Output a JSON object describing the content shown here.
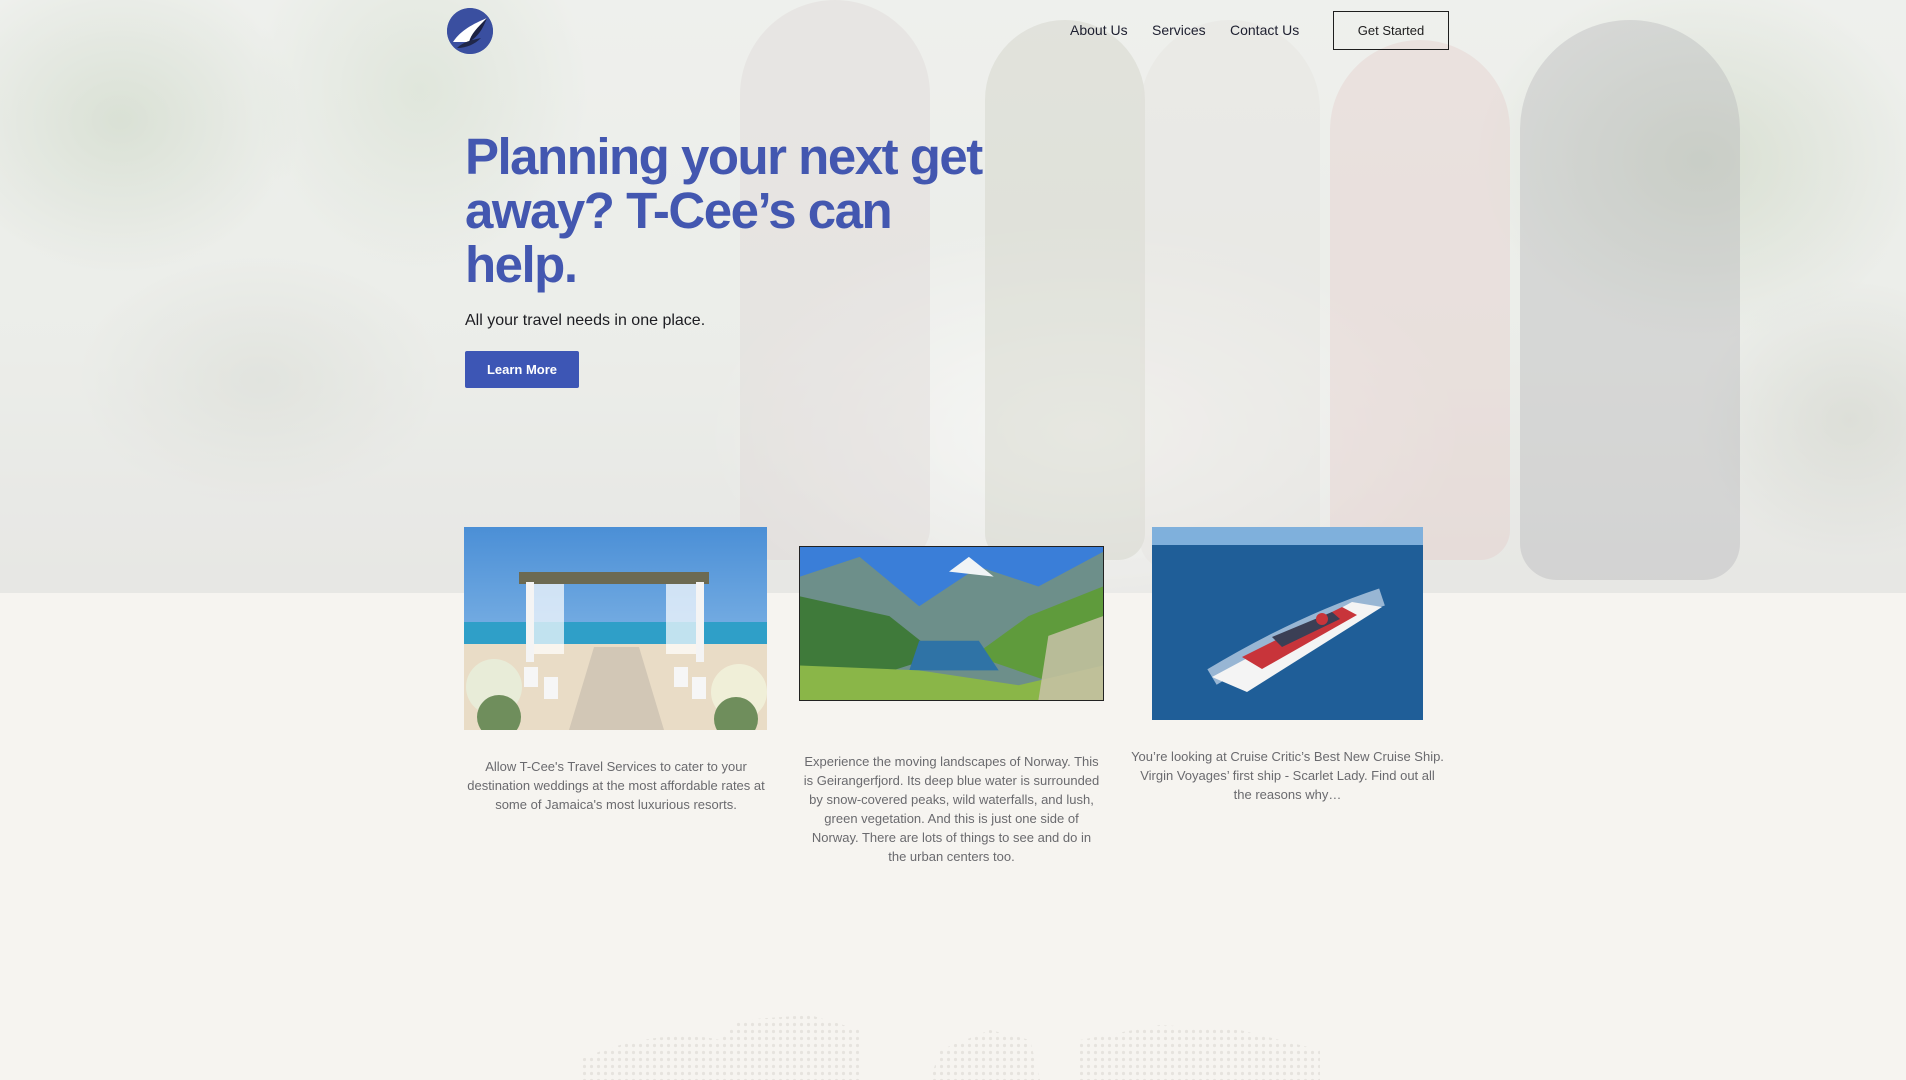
{
  "nav": {
    "links": [
      "About Us",
      "Services",
      "Contact Us"
    ],
    "cta_label": "Get Started"
  },
  "hero": {
    "headline": "Planning your next get away? T-Cee’s can help.",
    "subline": "All your travel needs in one place.",
    "button_label": "Learn More"
  },
  "cards": [
    {
      "text": "Allow T-Cee's Travel Services to cater to your destination weddings at the most affordable rates at some of Jamaica's most luxurious resorts."
    },
    {
      "text": "Experience the moving landscapes of Norway. This is Geirangerfjord. Its deep blue water is surrounded by snow-covered peaks, wild waterfalls, and lush, green vegetation. And this is just one side of Norway. There are lots of things to see and do in the urban centers too."
    },
    {
      "text": "You’re looking at Cruise Critic’s Best New Cruise Ship. Virgin Voyages’ first ship - Scarlet Lady. Find out all the reasons why…"
    }
  ],
  "colors": {
    "accent": "#4357b0",
    "button": "#3d56b5",
    "page_bg": "#f6f4f0",
    "body_text": "#6a6a6e"
  },
  "icons": {
    "logo": "bird-logo-icon"
  }
}
